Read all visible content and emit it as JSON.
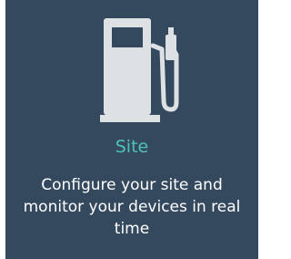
{
  "tile": {
    "icon": "fuel-pump-icon",
    "title": "Site",
    "description": "Configure your site and monitor your devices in real time",
    "colors": {
      "background": "#34495e",
      "icon": "#dde1e4",
      "title": "#4fc3b2",
      "text": "#ffffff"
    }
  }
}
